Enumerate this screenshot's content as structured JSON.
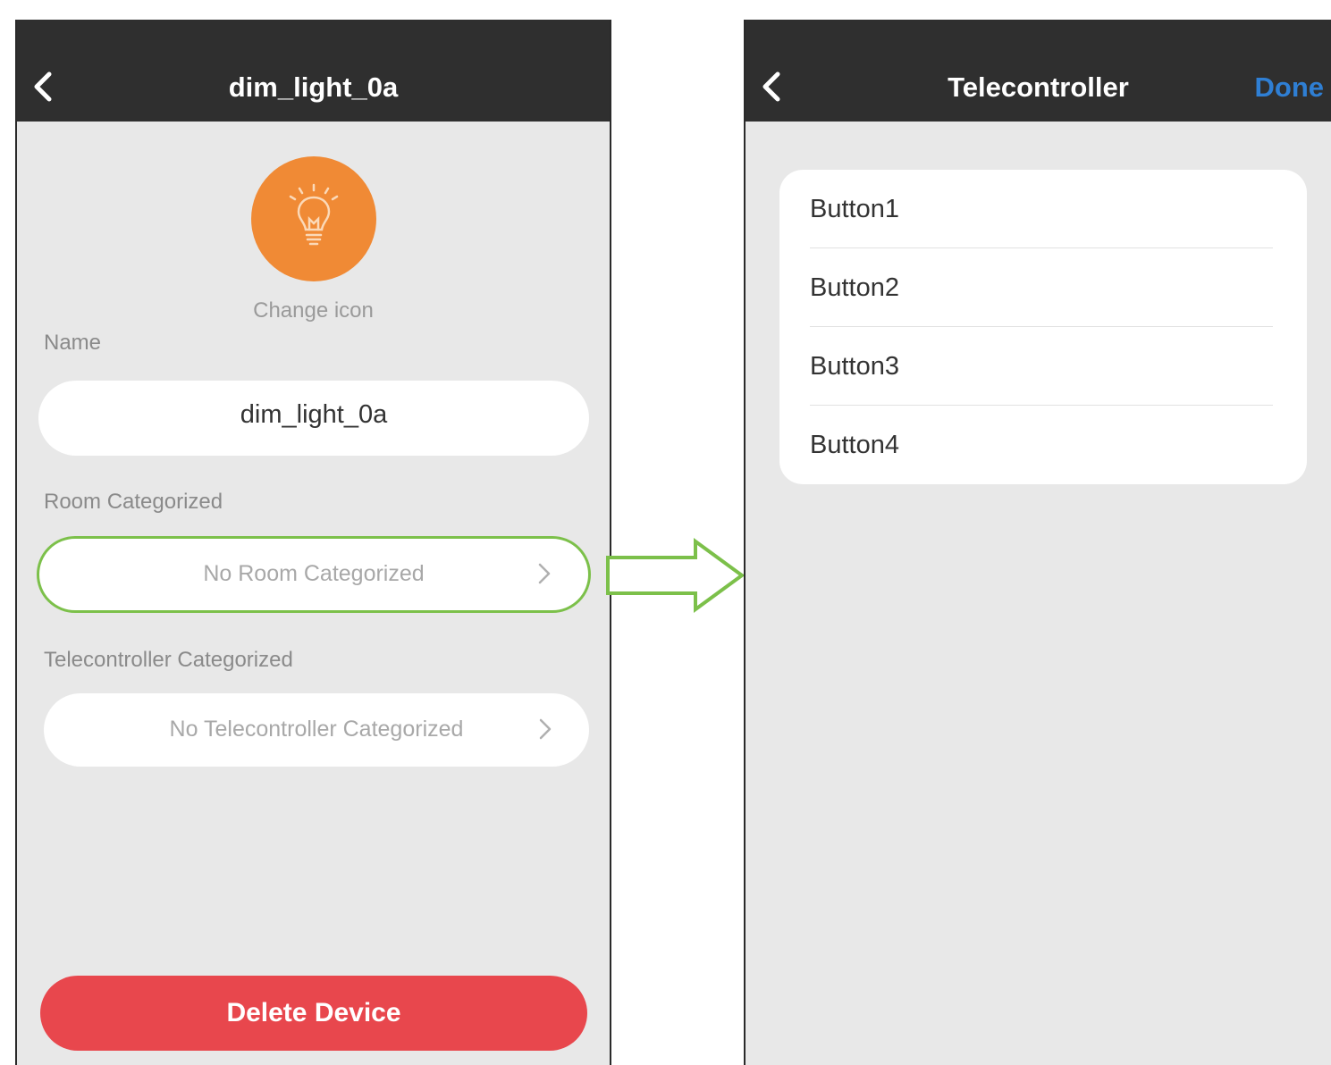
{
  "left_screen": {
    "title": "dim_light_0a",
    "change_icon_label": "Change icon",
    "name_label": "Name",
    "name_value": "dim_light_0a",
    "room_label": "Room Categorized",
    "room_value": "No Room Categorized",
    "telecontroller_label": "Telecontroller Categorized",
    "telecontroller_value": "No Telecontroller Categorized",
    "delete_label": "Delete Device",
    "icon": "light-bulb-icon"
  },
  "right_screen": {
    "title": "Telecontroller",
    "done_label": "Done",
    "items": [
      {
        "label": "Button1"
      },
      {
        "label": "Button2"
      },
      {
        "label": "Button3"
      },
      {
        "label": "Button4"
      }
    ]
  },
  "colors": {
    "navbar": "#2f2f2f",
    "icon_orange": "#f08a35",
    "highlight_green": "#7cc04a",
    "delete_red": "#e8474d",
    "done_blue": "#2f7fd4"
  }
}
